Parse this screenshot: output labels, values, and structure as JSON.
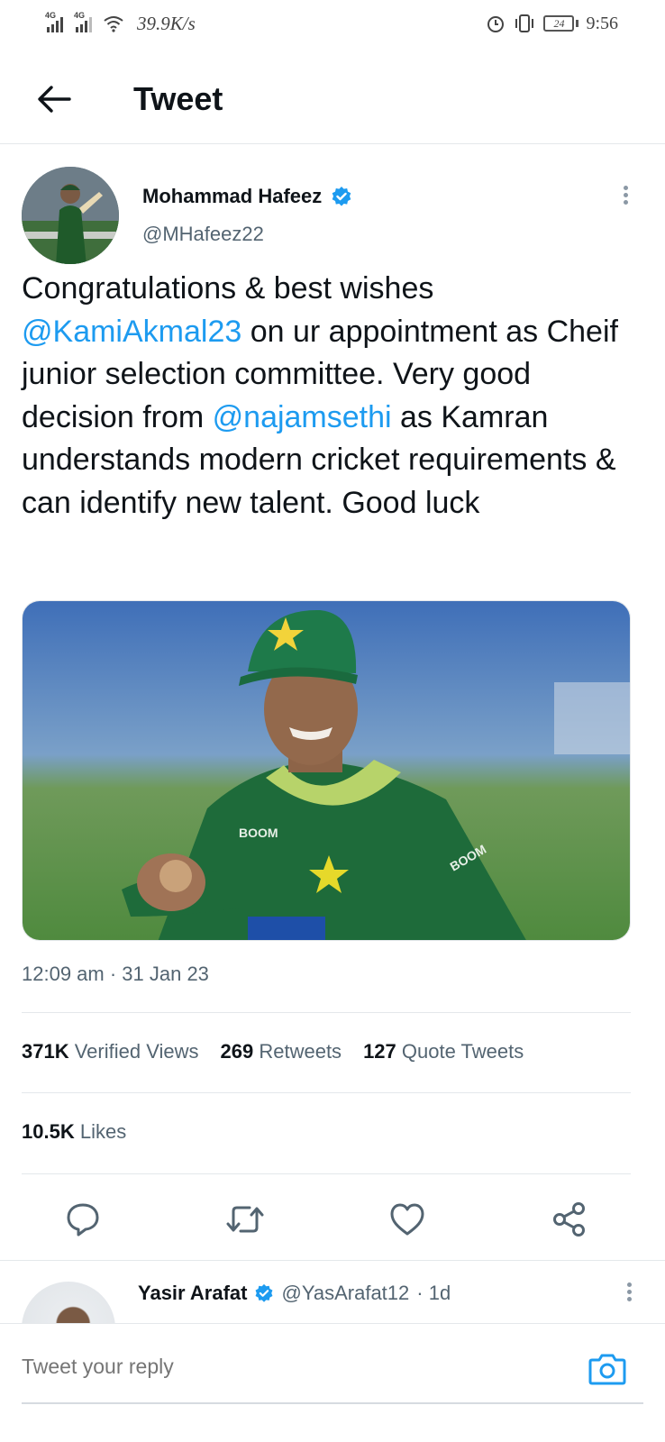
{
  "status_bar": {
    "net_type_1": "4G",
    "net_type_2": "4G",
    "speed": "39.9K/s",
    "battery": "24",
    "time": "9:56",
    "icons": [
      "signal-icon",
      "signal-icon",
      "wifi-icon",
      "alarm-icon",
      "vibrate-icon",
      "battery-icon"
    ]
  },
  "header": {
    "title": "Tweet",
    "back_icon": "arrow-left-icon"
  },
  "tweet": {
    "author_name": "Mohammad Hafeez",
    "author_handle": "@MHafeez22",
    "verified": true,
    "text": [
      {
        "type": "text",
        "value": "Congratulations & best wishes "
      },
      {
        "type": "mention",
        "value": "@KamiAkmal23"
      },
      {
        "type": "text",
        "value": " on ur appointment as Cheif junior selection committee. Very good decision from "
      },
      {
        "type": "mention",
        "value": "@najamsethi"
      },
      {
        "type": "text",
        "value": " as Kamran understands modern cricket requirements & can identify new talent. Good luck"
      }
    ],
    "timestamp": "12:09 am · 31 Jan 23",
    "stats": {
      "views_count": "371K",
      "views_label": "Verified Views",
      "retweets_count": "269",
      "retweets_label": "Retweets",
      "quotes_count": "127",
      "quotes_label": "Quote Tweets",
      "likes_count": "10.5K",
      "likes_label": "Likes"
    },
    "actions": [
      "reply-icon",
      "retweet-icon",
      "like-icon",
      "share-icon"
    ]
  },
  "reply_preview": {
    "name": "Yasir Arafat",
    "handle": "@YasArafat12",
    "age": "· 1d",
    "verified": true
  },
  "compose": {
    "placeholder": "Tweet your reply"
  },
  "colors": {
    "accent": "#1d9bf0",
    "text": "#0f1419",
    "secondary": "#536471",
    "divider": "#e4e8eb"
  }
}
